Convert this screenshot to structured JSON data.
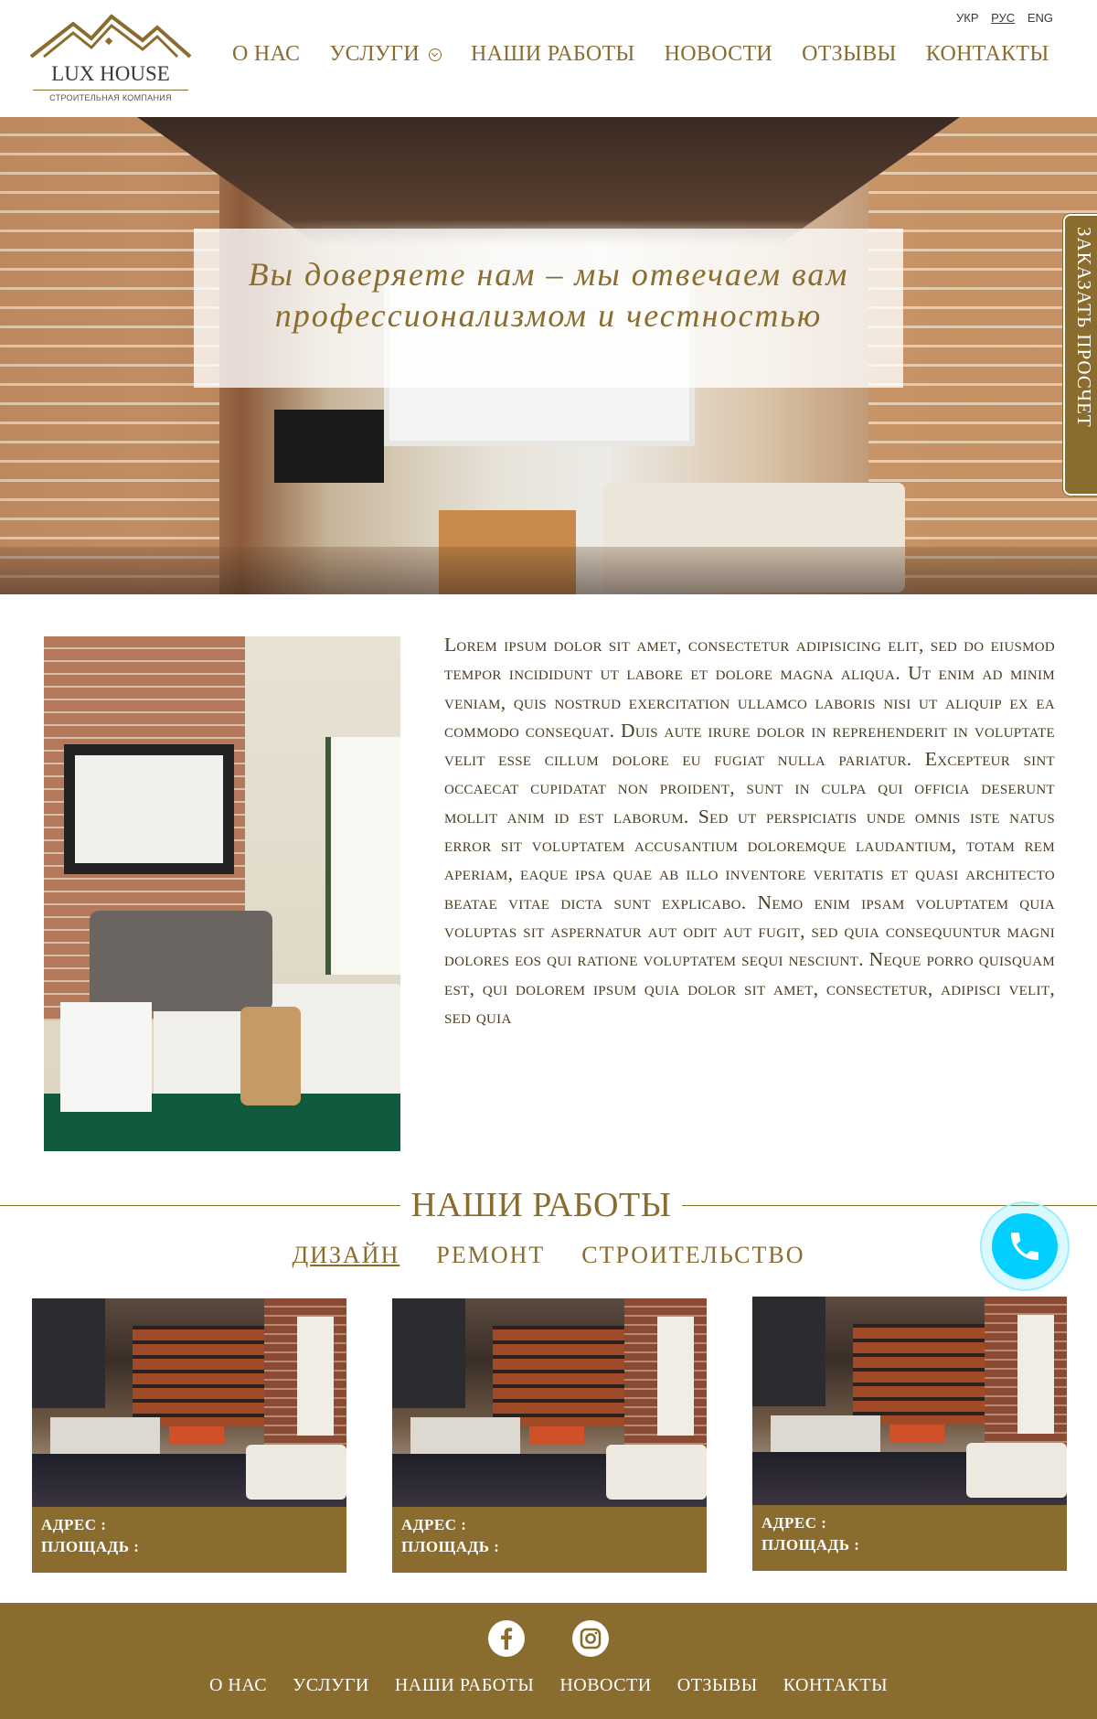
{
  "header": {
    "logo_title": "LUX HOUSE",
    "logo_subtitle": "СТРОИТЕЛЬНАЯ КОМПАНИЯ",
    "languages": [
      "УКР",
      "РУС",
      "ENG"
    ],
    "active_language": "РУС",
    "nav": [
      "О НАС",
      "УСЛУГИ",
      "НАШИ РАБОТЫ",
      "НОВОСТИ",
      "ОТЗЫВЫ",
      "КОНТАКТЫ"
    ]
  },
  "hero": {
    "slogan_line1": "Вы доверяете нам – мы отвечаем вам",
    "slogan_line2": "профессионализмом и честностью",
    "side_button": "ЗАКАЗАТЬ ПРОСЧЕТ"
  },
  "about": {
    "text": "Lorem ipsum dolor sit amet, consectetur adipisicing elit, sed do eiusmod tempor incididunt ut labore et dolore magna aliqua. Ut enim ad minim veniam, quis nostrud exercitation ullamco laboris nisi ut aliquip ex ea commodo consequat. Duis aute irure dolor in reprehenderit in voluptate velit esse cillum dolore eu fugiat nulla pariatur. Excepteur sint occaecat cupidatat non proident, sunt in culpa qui officia deserunt mollit anim id est laborum. Sed ut perspiciatis unde omnis iste natus error sit voluptatem accusantium doloremque laudantium, totam rem aperiam, eaque ipsa quae ab illo inventore veritatis et quasi architecto beatae vitae dicta sunt explicabo. Nemo enim ipsam voluptatem quia voluptas sit aspernatur aut odit aut fugit, sed quia consequuntur magni dolores eos qui ratione voluptatem sequi nesciunt. Neque porro quisquam est, qui dolorem ipsum quia dolor sit amet, consectetur, adipisci velit, sed quia"
  },
  "works": {
    "title": "НАШИ РАБОТЫ",
    "tabs": [
      "ДИЗАЙН",
      "РЕМОНТ",
      "СТРОИТЕЛЬСТВО"
    ],
    "active_tab": "ДИЗАЙН",
    "cards": [
      {
        "address_label": "АДРЕС :",
        "area_label": "ПЛОЩАДЬ :"
      },
      {
        "address_label": "АДРЕС :",
        "area_label": "ПЛОЩАДЬ :"
      },
      {
        "address_label": "АДРЕС :",
        "area_label": "ПЛОЩАДЬ :"
      }
    ]
  },
  "footer": {
    "social": [
      "facebook-icon",
      "instagram-icon"
    ],
    "nav": [
      "О НАС",
      "УСЛУГИ",
      "НАШИ РАБОТЫ",
      "НОВОСТИ",
      "ОТЗЫВЫ",
      "КОНТАКТЫ"
    ]
  },
  "colors": {
    "brand_gold": "#8b6c2f",
    "call_button": "#00cfff",
    "text_dark": "#4a3c20"
  }
}
